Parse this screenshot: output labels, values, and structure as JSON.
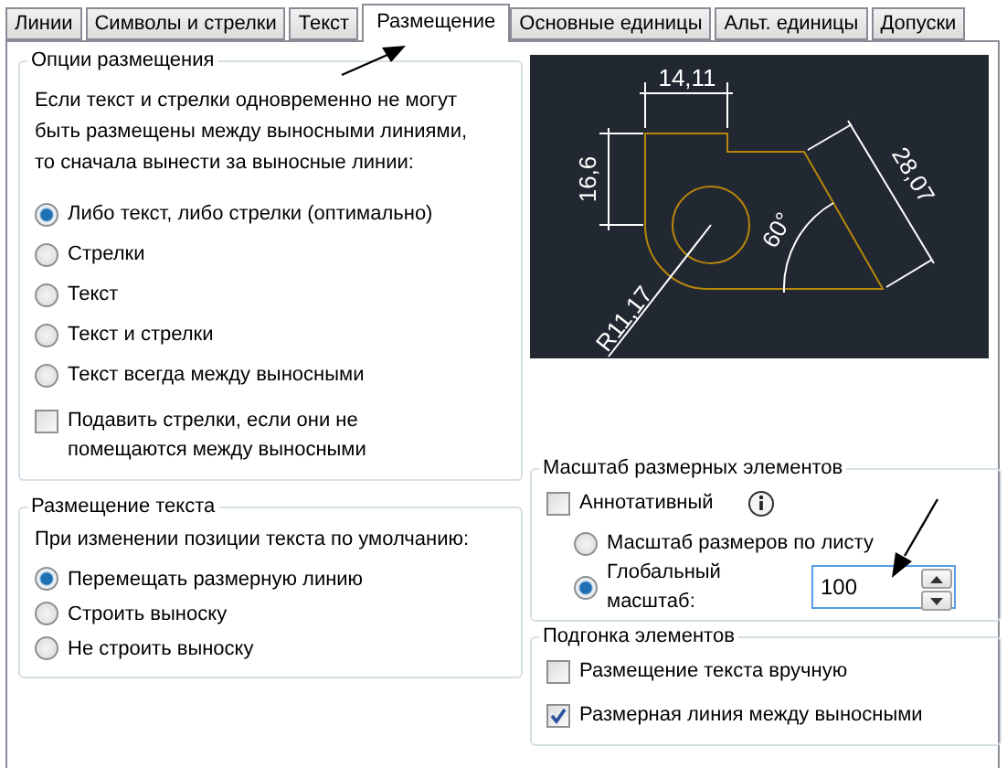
{
  "tabs": [
    {
      "label": "Линии",
      "selected": false
    },
    {
      "label": "Символы и стрелки",
      "selected": false
    },
    {
      "label": "Текст",
      "selected": false
    },
    {
      "label": "Размещение",
      "selected": true
    },
    {
      "label": "Основные единицы",
      "selected": false
    },
    {
      "label": "Альт. единицы",
      "selected": false
    },
    {
      "label": "Допуски",
      "selected": false
    }
  ],
  "fit_options": {
    "title": "Опции размещения",
    "description": "Если текст и стрелки одновременно не могут быть размещены между выносными линиями, то сначала вынести за выносные линии:",
    "options": [
      {
        "label": "Либо текст, либо стрелки (оптимально)",
        "selected": true
      },
      {
        "label": "Стрелки",
        "selected": false
      },
      {
        "label": "Текст",
        "selected": false
      },
      {
        "label": "Текст и стрелки",
        "selected": false
      },
      {
        "label": "Текст всегда между выносными",
        "selected": false
      }
    ],
    "suppress": {
      "label": "Подавить стрелки, если они не помещаются между выносными",
      "checked": false
    }
  },
  "text_placement": {
    "title": "Размещение текста",
    "description": "При изменении позиции текста по умолчанию:",
    "options": [
      {
        "label": "Перемещать размерную линию",
        "selected": true
      },
      {
        "label": "Строить выноску",
        "selected": false
      },
      {
        "label": "Не строить выноску",
        "selected": false
      }
    ]
  },
  "preview": {
    "labels": [
      "14,11",
      "16,6",
      "28,07",
      "60°",
      "R11,17"
    ]
  },
  "scale": {
    "title": "Масштаб размерных элементов",
    "annotative": {
      "label": "Аннотативный",
      "checked": false
    },
    "options": [
      {
        "label": "Масштаб размеров по листу",
        "selected": false
      },
      {
        "label": "Глобальный масштаб:",
        "selected": true
      }
    ],
    "value": "100"
  },
  "fine_tuning": {
    "title": "Подгонка элементов",
    "options": [
      {
        "label": "Размещение текста вручную",
        "checked": false
      },
      {
        "label": "Размерная линия между выносными",
        "checked": true
      }
    ]
  }
}
